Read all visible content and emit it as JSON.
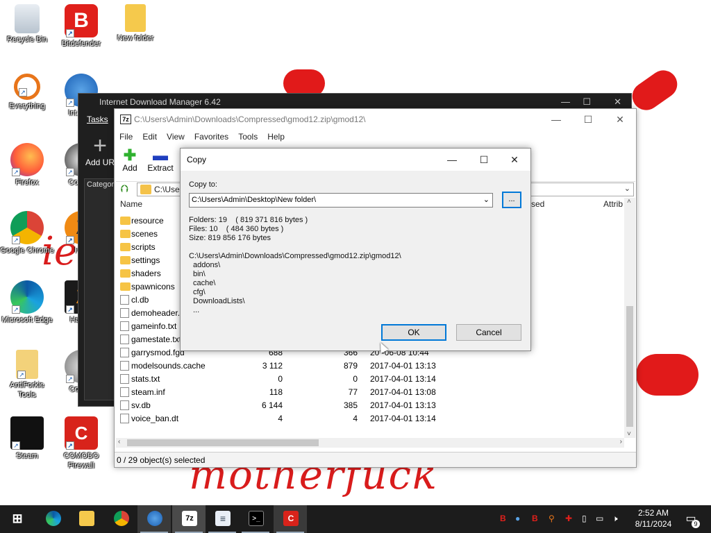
{
  "desktop": {
    "icons": [
      {
        "label": "Recycle Bin",
        "icon": "recycle-bin-icon"
      },
      {
        "label": "Bitdefender",
        "icon": "bitdefender-icon"
      },
      {
        "label": "New folder",
        "icon": "folder-icon"
      },
      {
        "label": "Everything",
        "icon": "everything-search-icon"
      },
      {
        "label": "Internet Download ...",
        "icon": "idm-icon"
      },
      {
        "label": "Firefox",
        "icon": "firefox-icon"
      },
      {
        "label": "Counter-Strike Source",
        "icon": "counter-strike-icon"
      },
      {
        "label": "Google Chrome",
        "icon": "chrome-icon"
      },
      {
        "label": "Half-Life 2",
        "icon": "half-life-icon"
      },
      {
        "label": "Microsoft Edge",
        "icon": "edge-icon"
      },
      {
        "label": "Half-Life Source",
        "icon": "half-life-source-icon"
      },
      {
        "label": "AntiForkie Tools",
        "icon": "folder-zip-icon"
      },
      {
        "label": "Comodo Dragon",
        "icon": "comodo-dragon-icon"
      },
      {
        "label": "Steam",
        "icon": "steam-icon"
      },
      {
        "label": "COMODO Firewall",
        "icon": "comodo-firewall-icon"
      }
    ],
    "wallpaper_text": "motherfuck",
    "wallpaper_fragment": "ie",
    "accent_color": "#e11a1a"
  },
  "idm": {
    "title": "Internet Download Manager 6.42",
    "menu_tasks": "Tasks",
    "add_url": "Add UR",
    "categories": "Categor"
  },
  "zip": {
    "title": "C:\\Users\\Admin\\Downloads\\Compressed\\gmod12.zip\\gmod12\\",
    "menu": [
      "File",
      "Edit",
      "View",
      "Favorites",
      "Tools",
      "Help"
    ],
    "toolbar": {
      "add": "Add",
      "extract": "Extract"
    },
    "address": "C:\\User",
    "columns": {
      "name": "Name",
      "packed": "sed",
      "attrib": "Attrib"
    },
    "rows": [
      {
        "name": "resource",
        "type": "folder",
        "size": "",
        "packed": "",
        "modified": ""
      },
      {
        "name": "scenes",
        "type": "folder",
        "size": "",
        "packed": "",
        "modified": ""
      },
      {
        "name": "scripts",
        "type": "folder",
        "size": "",
        "packed": "",
        "modified": ""
      },
      {
        "name": "settings",
        "type": "folder",
        "size": "",
        "packed": "",
        "modified": ""
      },
      {
        "name": "shaders",
        "type": "folder",
        "size": "",
        "packed": "",
        "modified": ""
      },
      {
        "name": "spawnicons",
        "type": "folder",
        "size": "",
        "packed": "",
        "modified": ""
      },
      {
        "name": "cl.db",
        "type": "file",
        "size": "",
        "packed": "",
        "modified": ""
      },
      {
        "name": "demoheader.",
        "type": "file",
        "size": "",
        "packed": "",
        "modified": ""
      },
      {
        "name": "gameinfo.txt",
        "type": "file",
        "size": "",
        "packed": "",
        "modified": ""
      },
      {
        "name": "gamestate.txt",
        "type": "file",
        "size": "",
        "packed": "",
        "modified": ""
      },
      {
        "name": "garrysmod.fgd",
        "type": "file",
        "size": "688",
        "packed": "366",
        "modified": "20 -06-08 10:44"
      },
      {
        "name": "modelsounds.cache",
        "type": "file",
        "size": "3 112",
        "packed": "879",
        "modified": "2017-04-01 13:13"
      },
      {
        "name": "stats.txt",
        "type": "file",
        "size": "0",
        "packed": "0",
        "modified": "2017-04-01 13:14"
      },
      {
        "name": "steam.inf",
        "type": "file",
        "size": "118",
        "packed": "77",
        "modified": "2017-04-01 13:08"
      },
      {
        "name": "sv.db",
        "type": "file",
        "size": "6 144",
        "packed": "385",
        "modified": "2017-04-01 13:13"
      },
      {
        "name": "voice_ban.dt",
        "type": "file",
        "size": "4",
        "packed": "4",
        "modified": "2017-04-01 13:14"
      }
    ],
    "status": "0 / 29 object(s) selected"
  },
  "copy_dialog": {
    "title": "Copy",
    "copy_to_label": "Copy to:",
    "destination": "C:\\Users\\Admin\\Desktop\\New folder\\",
    "browse": "...",
    "folders": "Folders: 19    ( 819 371 816 bytes )",
    "files": "Files: 10    ( 484 360 bytes )",
    "size": "Size: 819 856 176 bytes",
    "source": "C:\\Users\\Admin\\Downloads\\Compressed\\gmod12.zip\\gmod12\\",
    "items": [
      "addons\\",
      "bin\\",
      "cache\\",
      "cfg\\",
      "DownloadLists\\",
      "..."
    ],
    "ok": "OK",
    "cancel": "Cancel"
  },
  "taskbar": {
    "time": "2:52 AM",
    "date": "8/11/2024",
    "notifications": "9",
    "apps": [
      "start-icon",
      "edge-icon",
      "file-explorer-icon",
      "chrome-icon",
      "idm-icon",
      "7zip-icon",
      "notepad-icon",
      "terminal-icon",
      "comodo-icon"
    ]
  }
}
